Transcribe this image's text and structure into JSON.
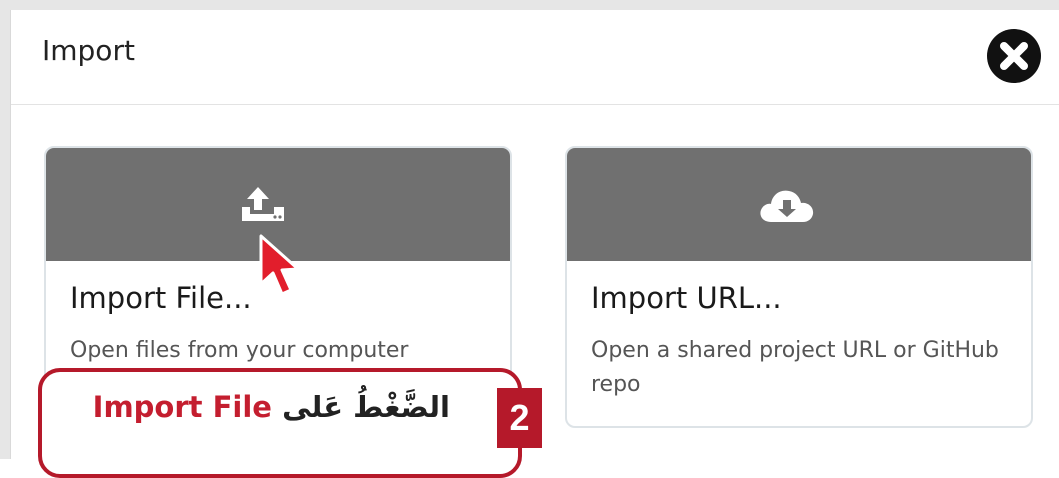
{
  "dialog": {
    "title": "Import",
    "close_icon": "close-icon"
  },
  "cards": [
    {
      "title": "Import File...",
      "description": "Open files from your computer",
      "icon": "upload-icon"
    },
    {
      "title": "Import URL...",
      "description": "Open a shared project URL or GitHub repo",
      "icon": "cloud-download-icon"
    }
  ],
  "callout": {
    "step_number": "2",
    "arabic_text": "الضَّغْطُ عَلى",
    "highlight": "Import File"
  },
  "colors": {
    "banner": "#707070",
    "accent_red": "#b5192a",
    "cursor_red": "#e21e2c"
  }
}
